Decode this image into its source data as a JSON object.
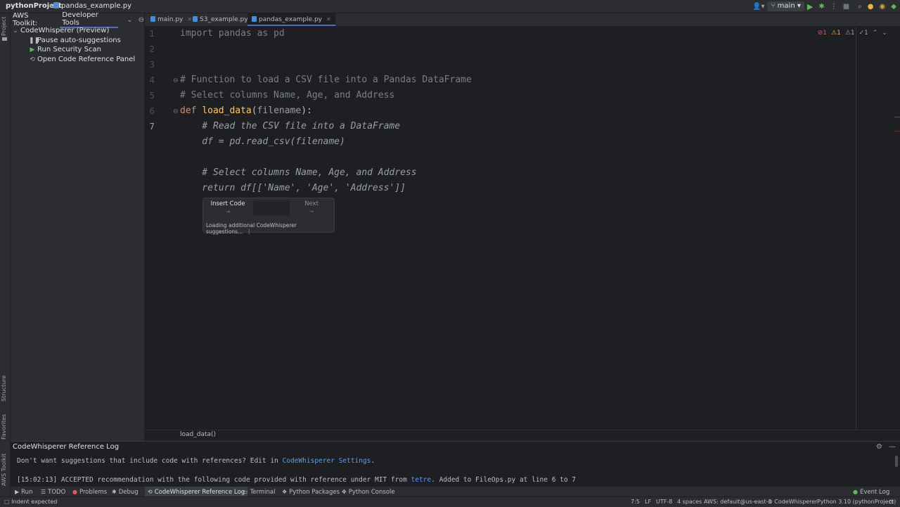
{
  "titlebar": {
    "project": "pythonProject",
    "file": "pandas_example.py",
    "branch": "main"
  },
  "left_strip": {
    "project": "Project",
    "structure": "Structure",
    "favorites": "Favorites",
    "aws_toolkit": "AWS Toolkit"
  },
  "sidebar": {
    "title": "AWS Toolkit:",
    "dropdown": "Developer Tools",
    "items": [
      {
        "label": "CodeWhisperer (Preview)",
        "icon": "chevron-down-icon"
      },
      {
        "label": "Pause auto-suggestions",
        "icon": "pause-icon"
      },
      {
        "label": "Run Security Scan",
        "icon": "play-icon"
      },
      {
        "label": "Open Code Reference Panel",
        "icon": "reference-icon"
      }
    ]
  },
  "tabs": [
    {
      "label": "main.py"
    },
    {
      "label": "S3_example.py"
    },
    {
      "label": "pandas_example.py",
      "active": true
    }
  ],
  "editor": {
    "line_numbers": [
      "1",
      "2",
      "3",
      "4",
      "5",
      "6",
      "7"
    ],
    "lines": {
      "l1": "import pandas as pd",
      "l4": "# Function to load a CSV file into a Pandas DataFrame",
      "l5": "# Select columns Name, Age, and Address",
      "l6_def": "def ",
      "l6_name": "load_data",
      "l6_open": "(",
      "l6_param": "filename",
      "l6_close": "):",
      "l7": "    # Read the CSV file into a DataFrame",
      "g1": "    df = pd.read_csv(filename)",
      "g2": "    # Select columns Name, Age, and Address",
      "g3": "    return df[['Name', 'Age', 'Address']]"
    },
    "inspections": {
      "errors": "1",
      "warnings": "1",
      "weak": "1",
      "typos": "1"
    }
  },
  "popup": {
    "insert": "Insert Code",
    "insert_hint": "⇥",
    "next": "Next",
    "next_hint": "→",
    "loading": "Loading additional CodeWhisperer suggestions..."
  },
  "breadcrumb": "load_data()",
  "bottom_panel": {
    "title": "CodeWhisperer Reference Log",
    "line1_prefix": "Don't want suggestions that include code with references? Edit in ",
    "line1_link": "CodeWhisperer Settings",
    "line1_suffix": ".",
    "line2_prefix": "[15:02:13] ACCEPTED recommendation with the following code provided with reference under MIT from ",
    "line2_link": "tetre",
    "line2_suffix": ". Added to FileOps.py at line 6 to 7"
  },
  "tool_windows": {
    "run": "Run",
    "todo": "TODO",
    "problems": "Problems",
    "debug": "Debug",
    "reference_log": "CodeWhisperer Reference Log",
    "terminal": "Terminal",
    "python_packages": "Python Packages",
    "python_console": "Python Console",
    "event_log": "Event Log"
  },
  "status": {
    "message": "Indent expected",
    "position": "7:5",
    "line_sep": "LF",
    "encoding": "UTF-8",
    "indent": "4 spaces",
    "aws": "AWS: default@us-east-1",
    "codewhisperer": "CodeWhisperer",
    "interpreter": "Python 3.10 (pythonProject)"
  },
  "colors": {
    "accent": "#4e6fbd",
    "link": "#589df6",
    "error": "#db5c5c",
    "warning": "#e8b34a",
    "run_green": "#5fb85f"
  }
}
